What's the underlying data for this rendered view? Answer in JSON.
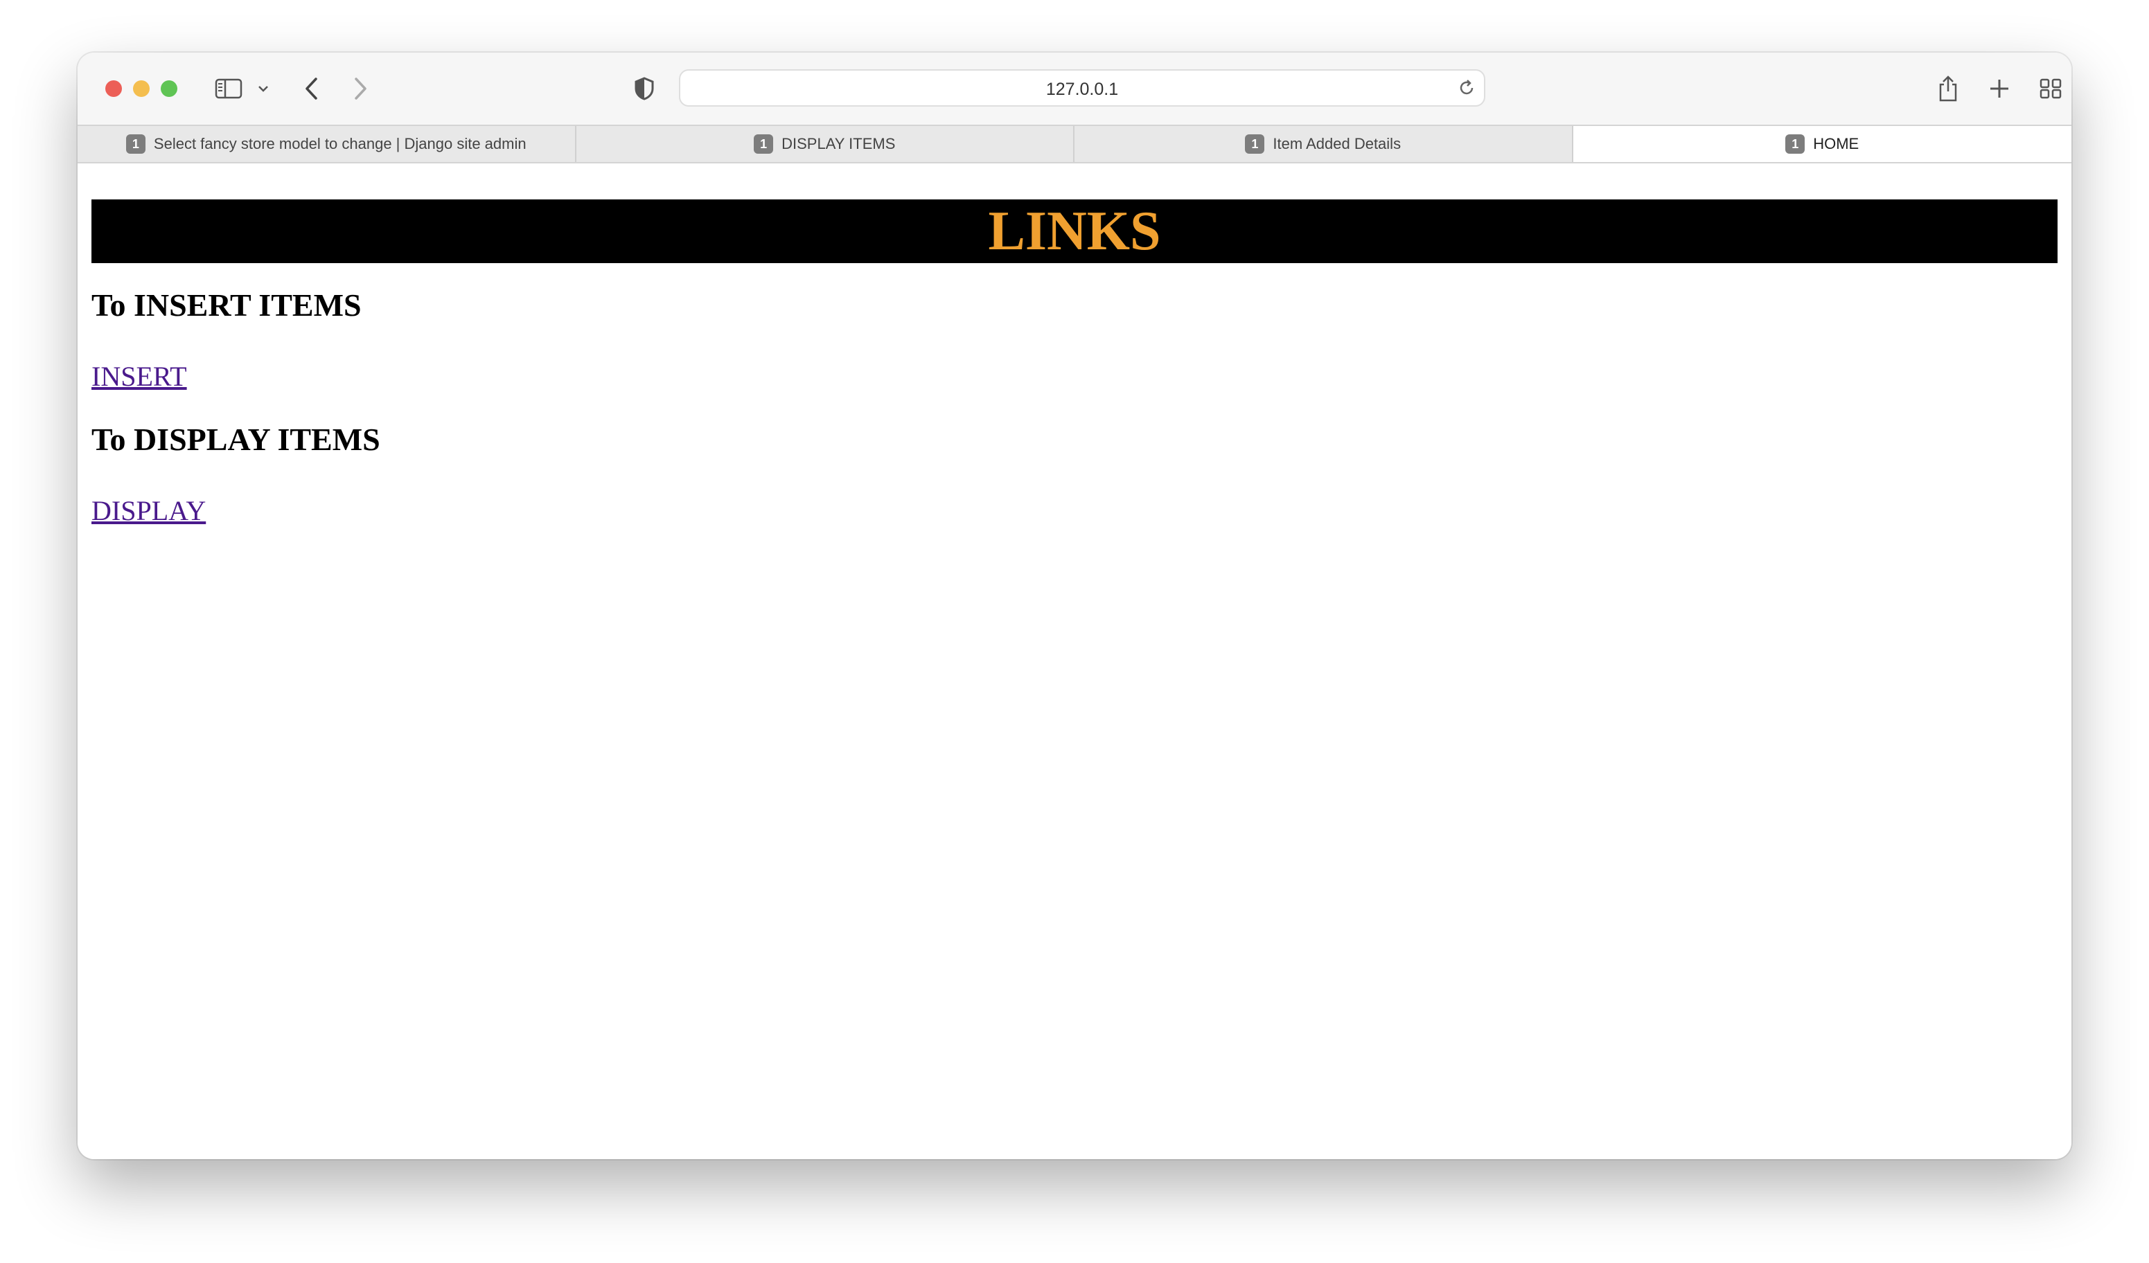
{
  "browser": {
    "address": "127.0.0.1",
    "tabs": [
      {
        "badge": "1",
        "title": "Select fancy store model to change | Django site admin",
        "active": false
      },
      {
        "badge": "1",
        "title": "DISPLAY ITEMS",
        "active": false
      },
      {
        "badge": "1",
        "title": "Item Added Details",
        "active": false
      },
      {
        "badge": "1",
        "title": "HOME",
        "active": true
      }
    ]
  },
  "page": {
    "banner_title": "LINKS",
    "insert_heading": "To INSERT ITEMS",
    "insert_link": "INSERT",
    "display_heading": "To DISPLAY ITEMS",
    "display_link": "DISPLAY"
  },
  "colors": {
    "banner_bg": "#000000",
    "banner_text": "#f0a030",
    "visited_link": "#4a1a8c"
  }
}
